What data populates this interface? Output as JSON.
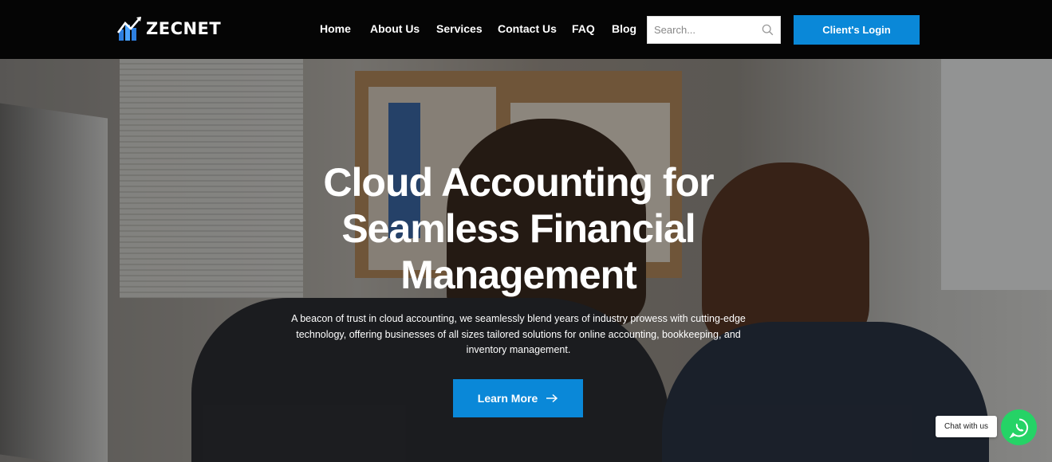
{
  "brand": {
    "name": "ZECNET"
  },
  "nav": {
    "items": [
      {
        "label": "Home"
      },
      {
        "label": "About Us"
      },
      {
        "label": "Services"
      },
      {
        "label": "Contact Us"
      },
      {
        "label": "FAQ"
      },
      {
        "label": "Blog"
      }
    ],
    "search_placeholder": "Search...",
    "login_label": "Client's Login"
  },
  "hero": {
    "title": "Cloud Accounting for Seamless Financial Management",
    "description": "A beacon of trust in cloud accounting, we seamlessly blend years of industry prowess with cutting-edge technology, offering businesses of all sizes tailored solutions for online accounting, bookkeeping, and inventory management.",
    "cta_label": "Learn More",
    "background_image": "two people at a computer in an office"
  },
  "chat": {
    "label": "Chat with us",
    "icon": "whatsapp-icon"
  },
  "colors": {
    "accent": "#0a88d8",
    "navbar": "#050505",
    "whatsapp": "#25d366"
  }
}
